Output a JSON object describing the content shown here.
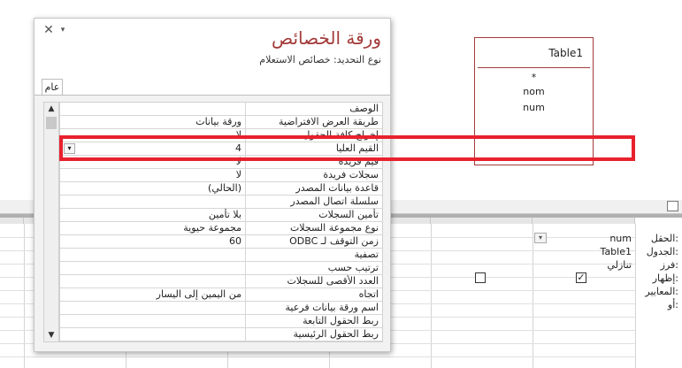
{
  "query_design": {
    "table_box": {
      "title": "Table1",
      "fields": [
        "*",
        "nom",
        "num"
      ]
    },
    "row_labels": [
      "الحقل:",
      "الجدول:",
      "فرز:",
      "إظهار:",
      "المعايير:",
      "أو:"
    ],
    "column1": {
      "field": "num",
      "table": "Table1",
      "sort": "تنازلي",
      "show": true
    },
    "column2": {
      "show": false
    }
  },
  "property_sheet": {
    "close_glyph": "✕",
    "arrow_glyph": "▾",
    "title": "ورقة الخصائص",
    "selection_type": "نوع التحديد:  خصائص الاستعلام",
    "tab_general": "عام",
    "rows": [
      {
        "label": "الوصف",
        "value": ""
      },
      {
        "label": "طريقة العرض الافتراضية",
        "value": "ورقة بيانات"
      },
      {
        "label": "إخراج كافة الحقول",
        "value": "لا"
      },
      {
        "label": "القيم العليا",
        "value": "4"
      },
      {
        "label": "قيم فريدة",
        "value": "لا"
      },
      {
        "label": "سجلات فريدة",
        "value": "لا"
      },
      {
        "label": "قاعدة بيانات المصدر",
        "value": "(الحالي)"
      },
      {
        "label": "سلسلة اتصال المصدر",
        "value": ""
      },
      {
        "label": "تأمين السجلات",
        "value": "بلا تأمين"
      },
      {
        "label": "نوع مجموعة السجلات",
        "value": "مجموعة حيوية"
      },
      {
        "label": "زمن التوقف لـ ODBC",
        "value": "60"
      },
      {
        "label": "تصفية",
        "value": ""
      },
      {
        "label": "ترتيب حسب",
        "value": ""
      },
      {
        "label": "العدد الأقصى للسجلات",
        "value": ""
      },
      {
        "label": "اتجاه",
        "value": "من اليمين إلى اليسار"
      },
      {
        "label": "اسم ورقة بيانات فرعية",
        "value": ""
      },
      {
        "label": "ربط الحقول التابعة",
        "value": ""
      },
      {
        "label": "ربط الحقول الرئيسية",
        "value": ""
      }
    ]
  },
  "colors": {
    "title": "#a33a3a",
    "highlight": "#e8212d"
  }
}
